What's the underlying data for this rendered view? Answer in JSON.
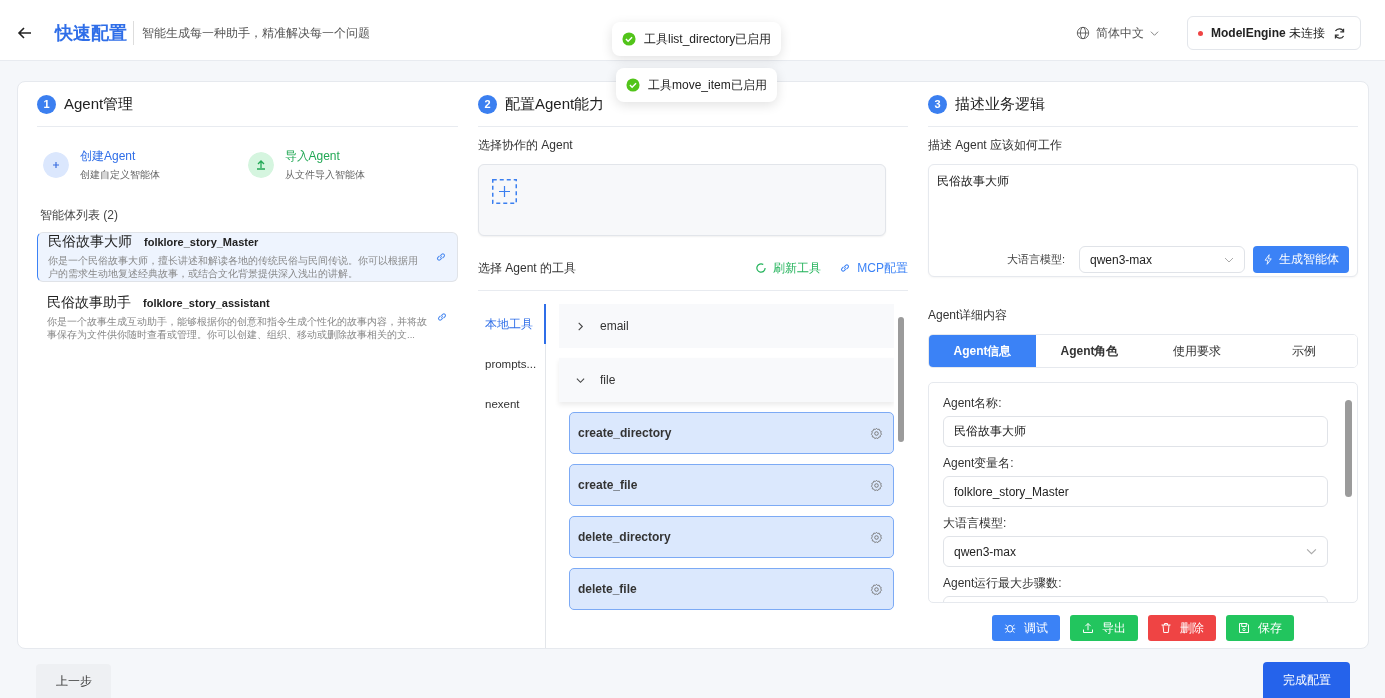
{
  "header": {
    "title": "快速配置",
    "subtitle": "智能生成每一种助手，精准解决每一个问题",
    "language": "简体中文",
    "connection": {
      "name": "ModelEngine",
      "status": "未连接",
      "connected": false
    }
  },
  "toasts": [
    {
      "text": "工具list_directory已启用"
    },
    {
      "text": "工具move_item已启用"
    }
  ],
  "steps": [
    {
      "number": "1",
      "title": "Agent管理"
    },
    {
      "number": "2",
      "title": "配置Agent能力"
    },
    {
      "number": "3",
      "title": "描述业务逻辑"
    }
  ],
  "agent_management": {
    "actions": [
      {
        "kind": "create",
        "title": "创建Agent",
        "subtitle": "创建自定义智能体"
      },
      {
        "kind": "import",
        "title": "导入Agent",
        "subtitle": "从文件导入智能体"
      }
    ],
    "list_title": "智能体列表 (2)",
    "agents": [
      {
        "name": "民俗故事大师",
        "variable": "folklore_story_Master",
        "description": "你是一个民俗故事大师，擅长讲述和解读各地的传统民俗与民间传说。你可以根据用户的需求生动地复述经典故事，或结合文化背景提供深入浅出的讲解。",
        "selected": true
      },
      {
        "name": "民俗故事助手",
        "variable": "folklore_story_assistant",
        "description": "你是一个故事生成互动助手，能够根据你的创意和指令生成个性化的故事内容，并将故事保存为文件供你随时查看或管理。你可以创建、组织、移动或删除故事相关的文...",
        "selected": false
      }
    ]
  },
  "capability": {
    "collab_label": "选择协作的 Agent",
    "tools_label": "选择 Agent 的工具",
    "refresh": "刷新工具",
    "mcp": "MCP配置",
    "categories": [
      {
        "label": "本地工具",
        "selected": true
      },
      {
        "label": "prompts...",
        "selected": false
      },
      {
        "label": "nexent",
        "selected": false
      }
    ],
    "groups": [
      {
        "name": "email",
        "expanded": false
      },
      {
        "name": "file",
        "expanded": true,
        "tools": [
          {
            "name": "create_directory",
            "selected": true
          },
          {
            "name": "create_file",
            "selected": true
          },
          {
            "name": "delete_directory",
            "selected": true
          },
          {
            "name": "delete_file",
            "selected": true
          }
        ]
      }
    ]
  },
  "logic": {
    "label": "描述 Agent 应该如何工作",
    "description": "民俗故事大师",
    "model_label": "大语言模型:",
    "model": "qwen3-max",
    "generate": "生成智能体",
    "details_label": "Agent详细内容",
    "tabs": [
      {
        "label": "Agent信息",
        "selected": true
      },
      {
        "label": "Agent角色",
        "selected": false
      },
      {
        "label": "使用要求",
        "selected": false
      },
      {
        "label": "示例",
        "selected": false
      }
    ],
    "fields": [
      {
        "kind": "input",
        "label": "Agent名称:",
        "value": "民俗故事大师"
      },
      {
        "kind": "input",
        "label": "Agent变量名:",
        "value": "folklore_story_Master"
      },
      {
        "kind": "select",
        "label": "大语言模型:",
        "value": "qwen3-max"
      },
      {
        "kind": "input",
        "label": "Agent运行最大步骤数:"
      }
    ],
    "actions": [
      {
        "kind": "debug",
        "label": "调试"
      },
      {
        "kind": "export",
        "label": "导出"
      },
      {
        "kind": "delete",
        "label": "删除"
      },
      {
        "kind": "save",
        "label": "保存"
      }
    ]
  },
  "footer": {
    "previous": "上一步",
    "finish": "完成配置"
  }
}
